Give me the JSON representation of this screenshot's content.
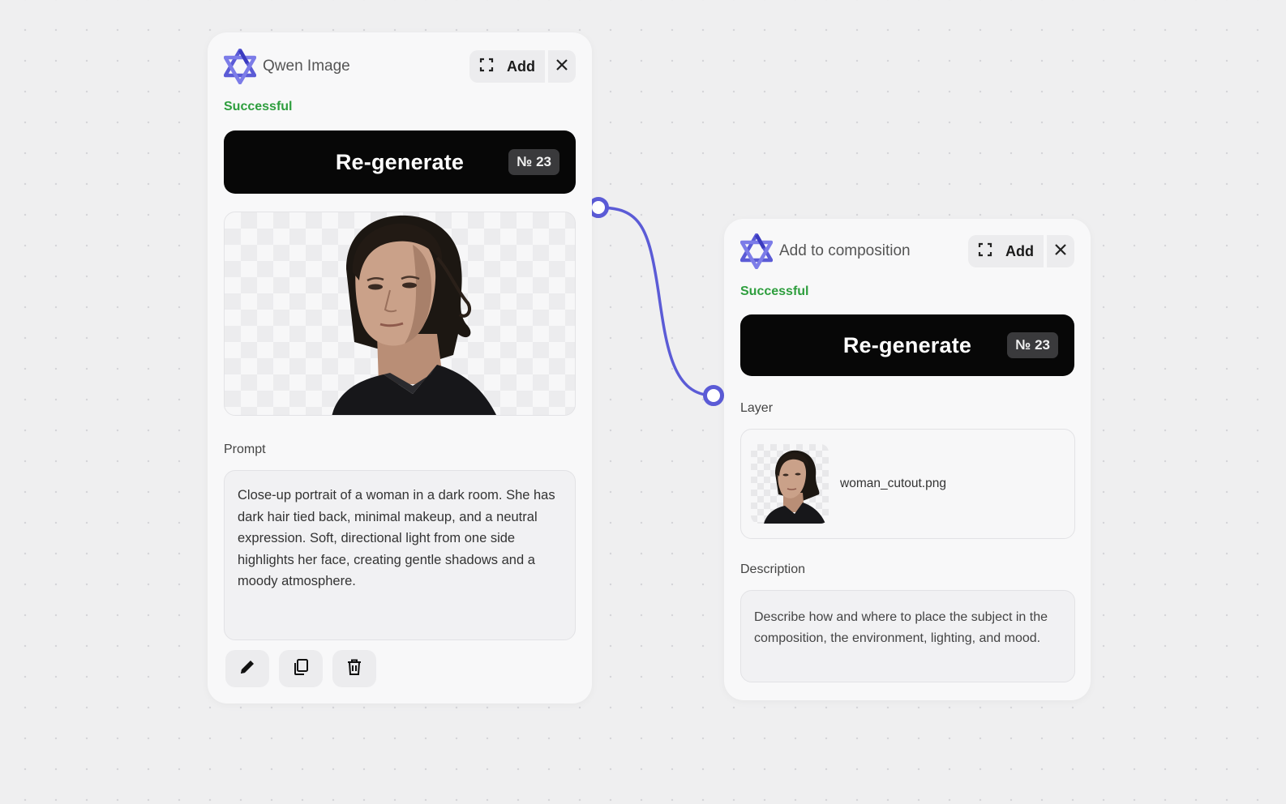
{
  "colors": {
    "accent": "#5b5bd6",
    "success": "#2e9e3e",
    "button_bg": "#070707",
    "canvas_bg": "#efeff0"
  },
  "nodes": [
    {
      "title": "Qwen Image",
      "logo_icon": "qwen-logo",
      "add_label": "Add",
      "expand_icon": "expand-icon",
      "close_icon": "close-icon",
      "status": "Successful",
      "regenerate_label": "Re-generate",
      "regenerate_count": "№ 23",
      "image_alt": "portrait of a woman on transparent background",
      "prompt_label": "Prompt",
      "prompt_text": "Close-up portrait of a woman in a dark room. She has dark hair tied back, minimal makeup, and a neutral expression. Soft, directional light from one side highlights her face, creating gentle shadows and a moody atmosphere.",
      "tools": [
        "edit-icon",
        "copy-icon",
        "trash-icon"
      ]
    },
    {
      "title": "Add to composition",
      "logo_icon": "qwen-logo",
      "add_label": "Add",
      "expand_icon": "expand-icon",
      "close_icon": "close-icon",
      "status": "Successful",
      "regenerate_label": "Re-generate",
      "regenerate_count": "№ 23",
      "layer_label": "Layer",
      "layer_file": "woman_cutout.png",
      "description_label": "Description",
      "description_text": "Describe how and where to place the subject in the composition, the environment, lighting, and mood."
    }
  ]
}
